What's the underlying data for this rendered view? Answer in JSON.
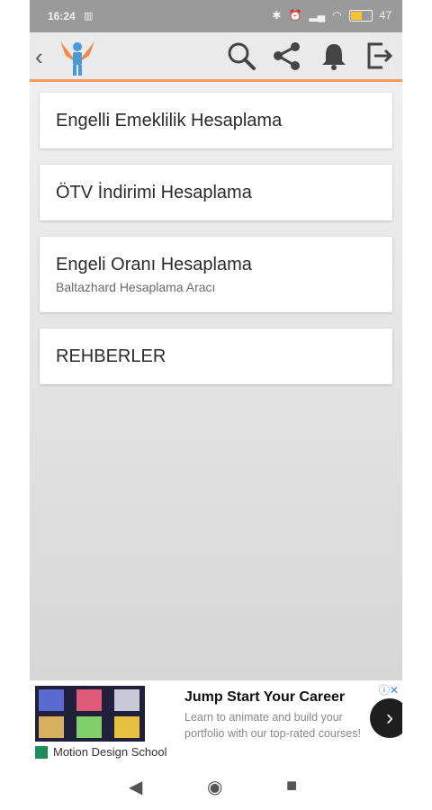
{
  "status_bar": {
    "time": "16:24",
    "battery": "47"
  },
  "toolbar": {
    "back_icon": "chevron-left-icon",
    "logo": "winged-figure-logo",
    "actions": [
      "search-icon",
      "share-icon",
      "bell-icon",
      "exit-icon"
    ]
  },
  "menu": [
    {
      "title": "Engelli Emeklilik Hesaplama"
    },
    {
      "title": "ÖTV İndirimi Hesaplama"
    },
    {
      "title": "Engeli Oranı Hesaplama",
      "subtitle": "Baltazhard Hesaplama Aracı"
    },
    {
      "title": "REHBERLER"
    }
  ],
  "ad": {
    "headline": "Jump Start Your Career",
    "body": "Learn to animate and build your portfolio with our top-rated courses!",
    "advertiser": "Motion Design School"
  },
  "colors": {
    "accent": "#f39b63",
    "toolbar_bg": "#eaeaea",
    "status_bg": "#9a9a9a"
  }
}
